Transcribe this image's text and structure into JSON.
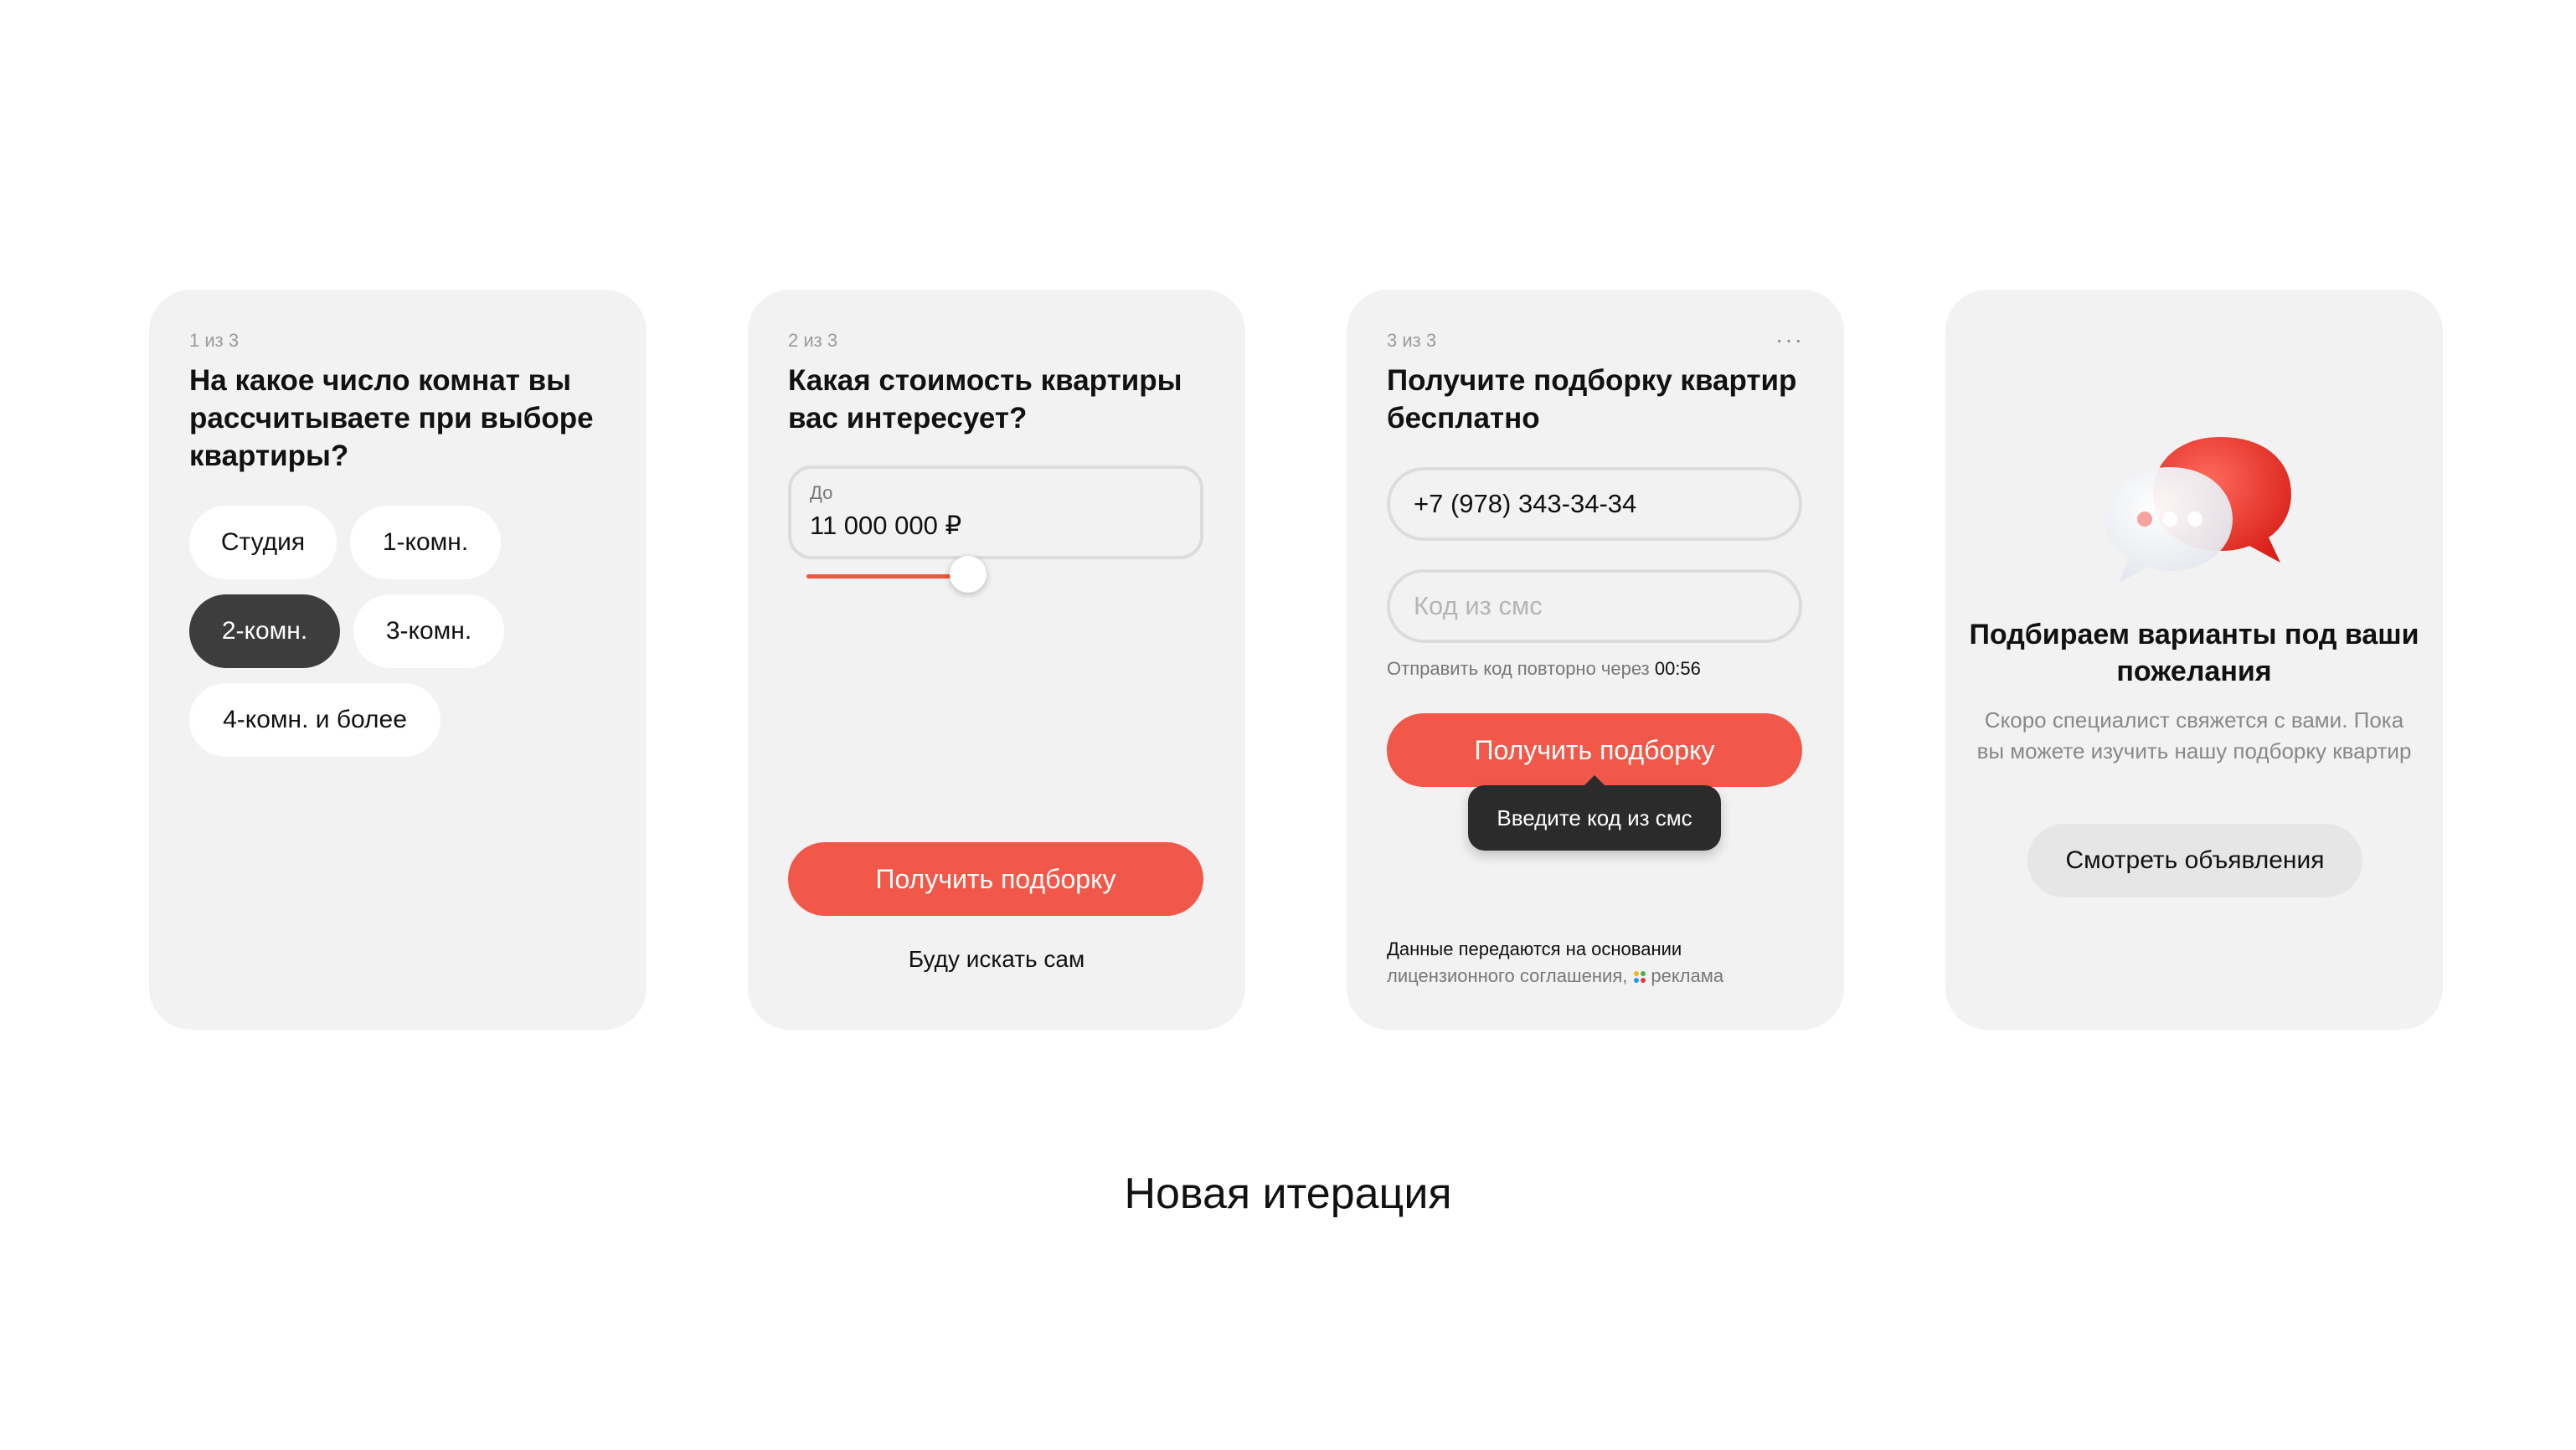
{
  "card1": {
    "step": "1 из 3",
    "heading": "На какое число комнат вы рассчитываете при выборе квартиры?",
    "options": [
      "Студия",
      "1-комн.",
      "2-комн.",
      "3-комн.",
      "4-комн. и более"
    ],
    "selected_option": "2-комн."
  },
  "card2": {
    "step": "2 из 3",
    "heading": "Какая стоимость квартиры вас интересует?",
    "price_label": "До",
    "price_value": "11 000 000 ₽",
    "slider_fraction": 0.42,
    "submit_label": "Получить подборку",
    "self_search_label": "Буду искать сам"
  },
  "card3": {
    "step": "3 из 3",
    "menu_label": "···",
    "heading": "Получите подборку квартир бесплатно",
    "phone_value": "+7 (978) 343-34-34",
    "sms_placeholder": "Код из смс",
    "resend_text": "Отправить код повторно через",
    "resend_timer": "00:56",
    "submit_label": "Получить подборку",
    "tooltip": "Введите код из смс",
    "legal_line1": "Данные передаются на основании",
    "legal_line2": "лицензионного соглашения,",
    "ad_label": "реклама"
  },
  "card4": {
    "title": "Подбираем варианты под ваши пожелания",
    "text": "Скоро специалист свяжется с вами. Пока вы можете изучить нашу подборку квартир",
    "button_label": "Смотреть объявления",
    "icon": "chat-bubbles-icon"
  },
  "caption": "Новая итерация",
  "colors": {
    "accent": "#f2584a",
    "card_bg": "#f2f2f2",
    "selected_chip": "#3d3d3d"
  }
}
